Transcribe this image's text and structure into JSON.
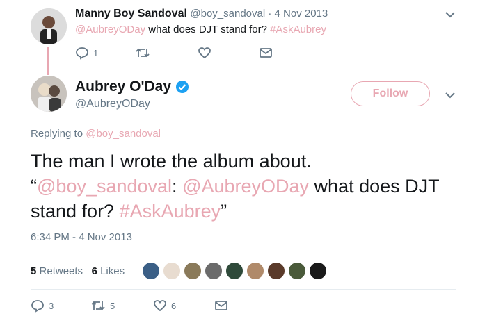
{
  "reply_tweet": {
    "name": "Manny Boy Sandoval",
    "handle_time": "@boy_sandoval · 4 Nov 2013",
    "text": {
      "mention": "@AubreyODay",
      "body": " what does DJT stand for? ",
      "hashtag": "#AskAubrey"
    },
    "actions": {
      "reply_count": "1"
    }
  },
  "main_tweet": {
    "name": "Aubrey O'Day",
    "handle": "@AubreyODay",
    "follow_label": "Follow",
    "replying_prefix": "Replying to ",
    "replying_to": "@boy_sandoval",
    "text": {
      "line1": "The man I wrote the album about.",
      "open_quote": "“",
      "mention1": "@boy_sandoval",
      "colon": ": ",
      "mention2": "@AubreyODay",
      "body": " what does DJT stand for? ",
      "hashtag": "#AskAubrey",
      "close_quote": "”"
    },
    "timestamp": "6:34 PM - 4 Nov 2013",
    "stats": {
      "retweets_count": "5",
      "retweets_label": "Retweets",
      "likes_count": "6",
      "likes_label": "Likes"
    },
    "actions": {
      "reply_count": "3",
      "retweet_count": "5",
      "like_count": "6"
    }
  },
  "colors": {
    "link": "#e8a7b2",
    "muted": "#657786",
    "verified": "#1da1f2",
    "text": "#14171a"
  },
  "likers": [
    {
      "color": "#3b5f86"
    },
    {
      "color": "#e8dcd0"
    },
    {
      "color": "#8a7a5a"
    },
    {
      "color": "#6b6b6b"
    },
    {
      "color": "#2f4a3a"
    },
    {
      "color": "#b08a6a"
    },
    {
      "color": "#5a3a2a"
    },
    {
      "color": "#4a5a3a"
    },
    {
      "color": "#1a1a1a"
    }
  ]
}
